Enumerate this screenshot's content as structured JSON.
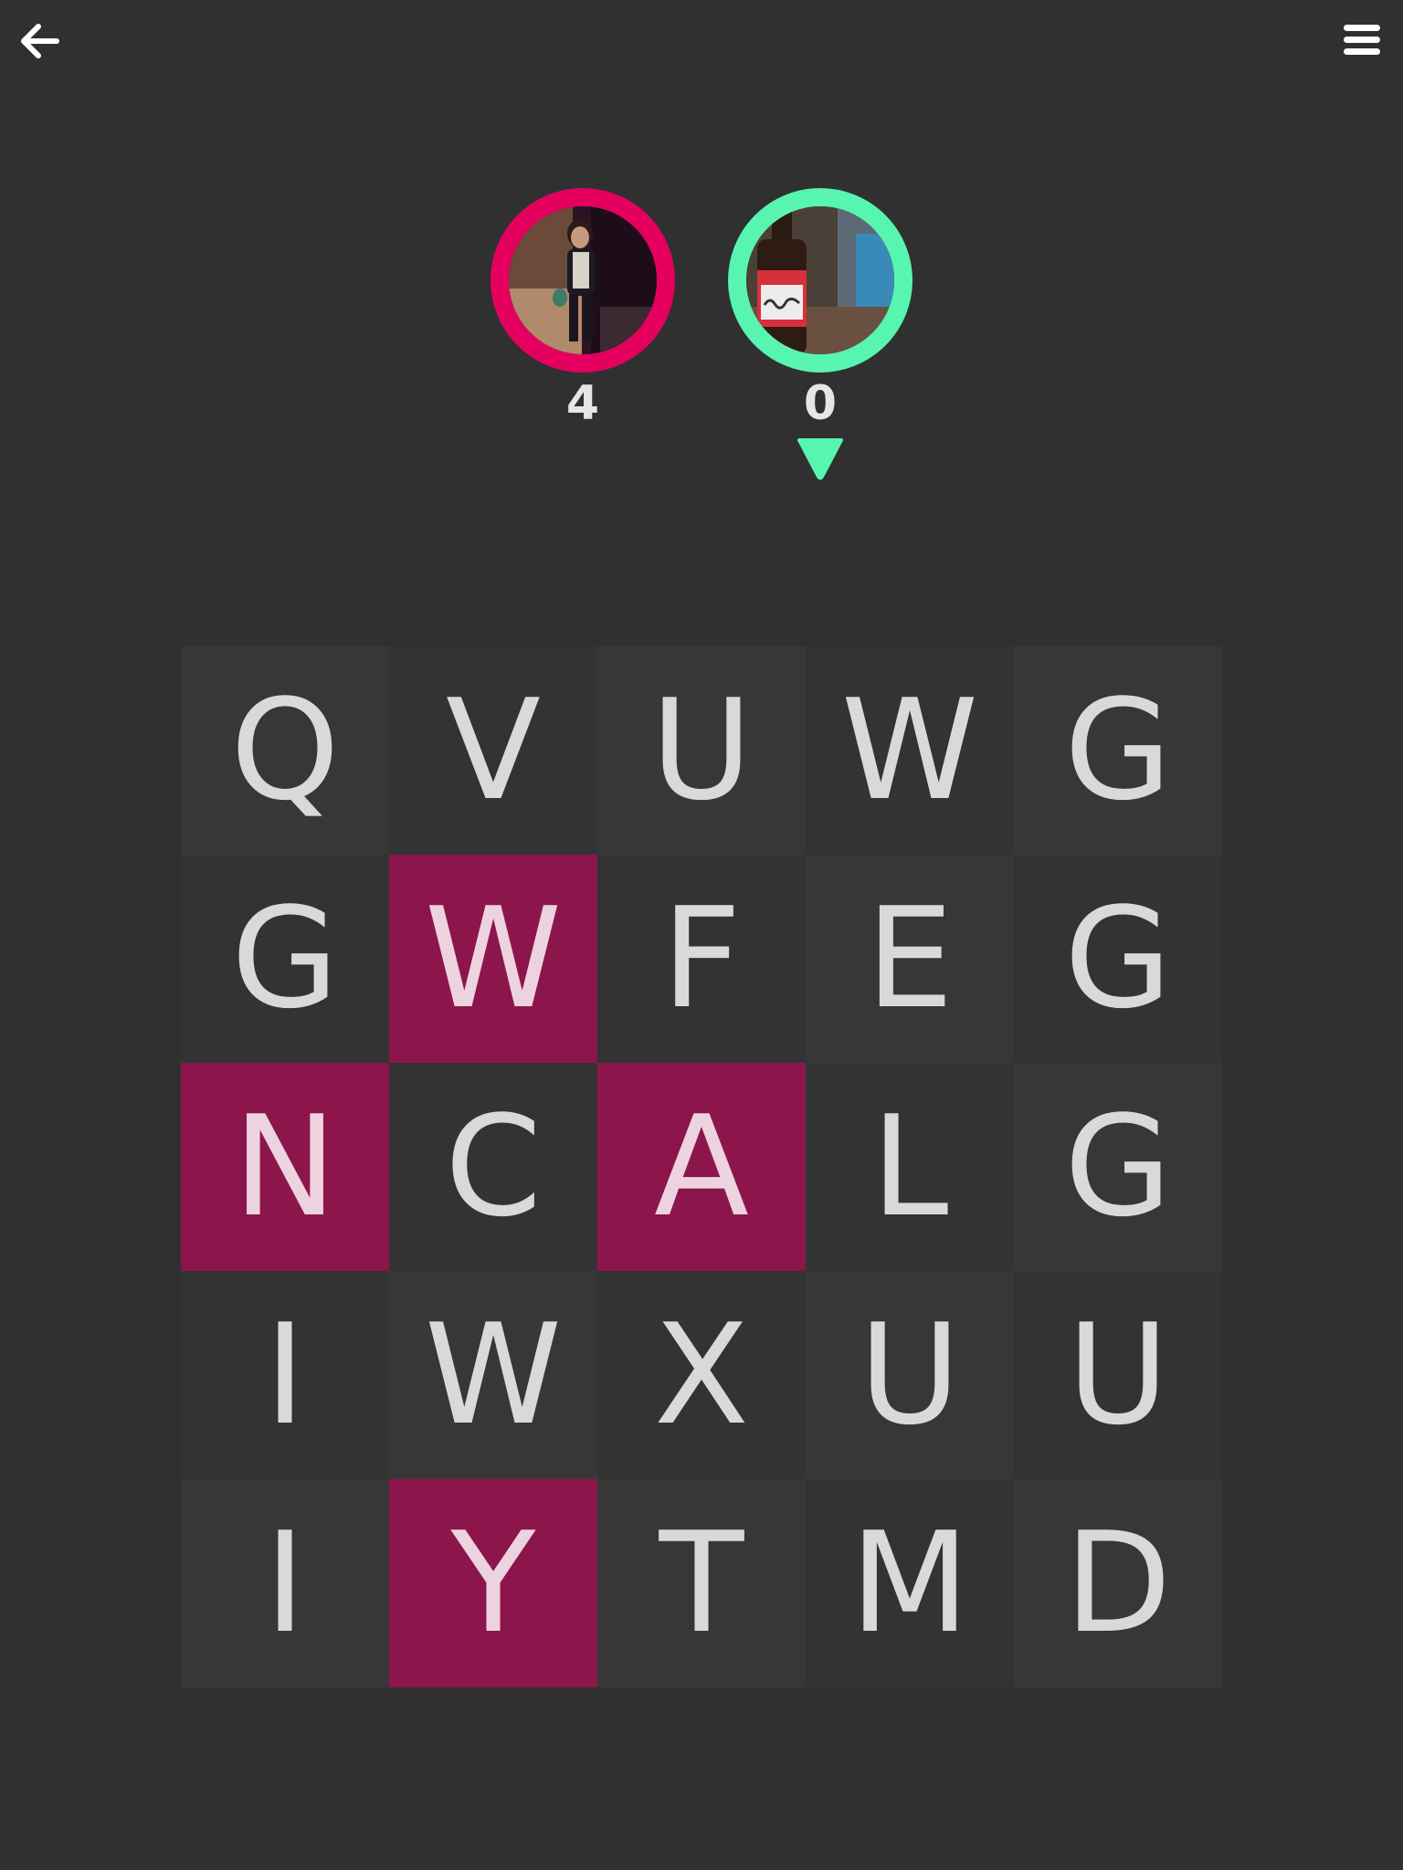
{
  "players": [
    {
      "score": "4",
      "ring_color": "#e5005f"
    },
    {
      "score": "0",
      "ring_color": "#58f5b0"
    }
  ],
  "turn_indicator_color": "#58f5b0",
  "board": {
    "letters": [
      [
        "Q",
        "V",
        "U",
        "W",
        "G"
      ],
      [
        "G",
        "W",
        "F",
        "E",
        "G"
      ],
      [
        "N",
        "C",
        "A",
        "L",
        "G"
      ],
      [
        "I",
        "W",
        "X",
        "U",
        "U"
      ],
      [
        "I",
        "Y",
        "T",
        "M",
        "D"
      ]
    ],
    "selected": [
      [
        false,
        false,
        false,
        false,
        false
      ],
      [
        false,
        true,
        false,
        false,
        false
      ],
      [
        true,
        false,
        true,
        false,
        false
      ],
      [
        false,
        false,
        false,
        false,
        false
      ],
      [
        false,
        true,
        false,
        false,
        false
      ]
    ],
    "selected_color": "#8c164c"
  },
  "icons": {
    "back": "back-arrow-icon",
    "menu": "hamburger-menu-icon",
    "turn": "triangle-down-icon"
  }
}
